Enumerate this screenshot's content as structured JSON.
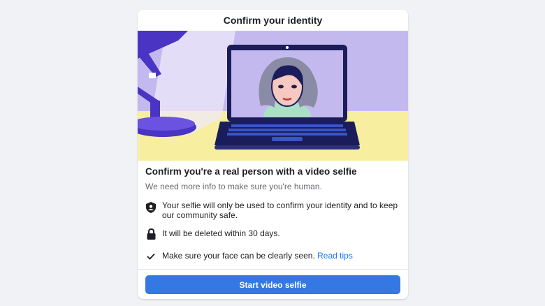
{
  "dialog": {
    "title": "Confirm your identity",
    "headline": "Confirm you're a real person with a video selfie",
    "subtext": "We need more info to make sure you're human.",
    "info_items": [
      {
        "icon": "shield-person-icon",
        "text": "Your selfie will only be used to confirm your identity and to keep our community safe."
      },
      {
        "icon": "lock-icon",
        "text": "It will be deleted within 30 days."
      },
      {
        "icon": "check-icon",
        "text": "Make sure your face can be clearly seen.",
        "link": "Read tips"
      }
    ],
    "primary_button": "Start video selfie"
  },
  "colors": {
    "page_background": "#f0f2f5",
    "illustration_background": "#c4b9ef",
    "desk": "#f7ef9f",
    "laptop": "#1a1d5a",
    "lamp": "#4a34c4",
    "link": "#1877f2",
    "primary_button": "#3478e4"
  }
}
